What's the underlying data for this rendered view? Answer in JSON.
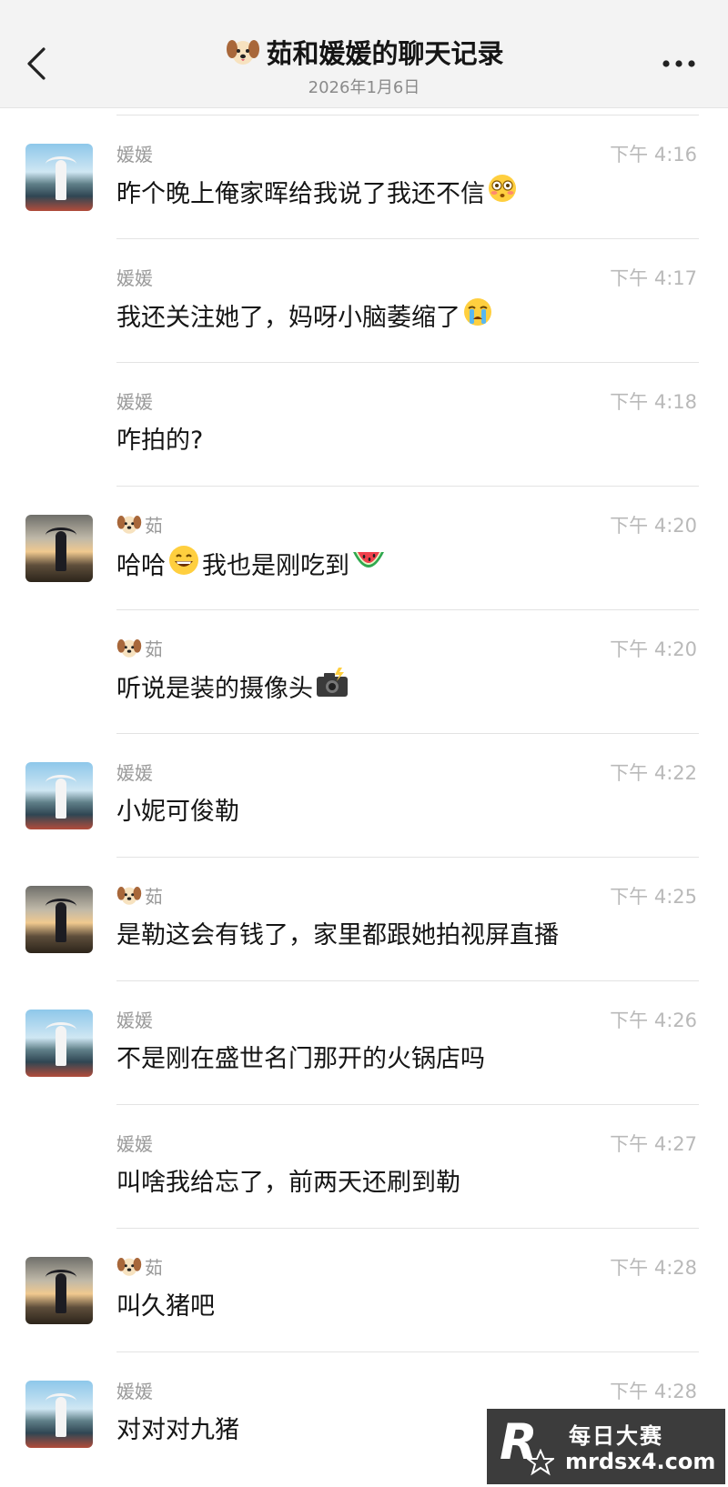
{
  "header": {
    "title": "茹和媛媛的聊天记录",
    "subtitle": "2026年1月6日",
    "icons": {
      "back": "chevron-left-icon",
      "more": "more-dots-icon",
      "title_emoji": "dog-face-emoji"
    }
  },
  "messages": [
    {
      "sender": "媛媛",
      "time": "下午 4:16",
      "text": "昨个晚上俺家晖给我说了我还不信",
      "emoji": "flushed-face",
      "avatar": "yuan",
      "show_avatar": true
    },
    {
      "sender": "媛媛",
      "time": "下午 4:17",
      "text": "我还关注她了，妈呀小脑萎缩了",
      "emoji": "crying-face",
      "avatar": "yuan",
      "show_avatar": false
    },
    {
      "sender": "媛媛",
      "time": "下午 4:18",
      "text": "咋拍的?",
      "emoji": "",
      "avatar": "yuan",
      "show_avatar": false
    },
    {
      "sender": "茹",
      "time": "下午 4:20",
      "text_before": "哈哈",
      "emoji_mid": "grinning-face",
      "text": "我也是刚吃到",
      "emoji": "watermelon",
      "avatar": "ru",
      "show_avatar": true,
      "sender_emoji": "dog-face"
    },
    {
      "sender": "茹",
      "time": "下午 4:20",
      "text": "听说是装的摄像头",
      "emoji": "camera-with-flash",
      "avatar": "ru",
      "show_avatar": false,
      "sender_emoji": "dog-face"
    },
    {
      "sender": "媛媛",
      "time": "下午 4:22",
      "text": "小妮可俊勒",
      "emoji": "",
      "avatar": "yuan",
      "show_avatar": true
    },
    {
      "sender": "茹",
      "time": "下午 4:25",
      "text": "是勒这会有钱了，家里都跟她拍视屏直播",
      "emoji": "",
      "avatar": "ru",
      "show_avatar": true,
      "sender_emoji": "dog-face"
    },
    {
      "sender": "媛媛",
      "time": "下午 4:26",
      "text": "不是刚在盛世名门那开的火锅店吗",
      "emoji": "",
      "avatar": "yuan",
      "show_avatar": true
    },
    {
      "sender": "媛媛",
      "time": "下午 4:27",
      "text": "叫啥我给忘了，前两天还刷到勒",
      "emoji": "",
      "avatar": "yuan",
      "show_avatar": false
    },
    {
      "sender": "茹",
      "time": "下午 4:28",
      "text": "叫久猪吧",
      "emoji": "",
      "avatar": "ru",
      "show_avatar": true,
      "sender_emoji": "dog-face"
    },
    {
      "sender": "媛媛",
      "time": "下午 4:28",
      "text": "对对对九猪",
      "emoji": "",
      "avatar": "yuan",
      "show_avatar": true
    }
  ],
  "watermark": {
    "logo": "R",
    "name": "每日大赛",
    "url": "mrdsx4.com"
  }
}
